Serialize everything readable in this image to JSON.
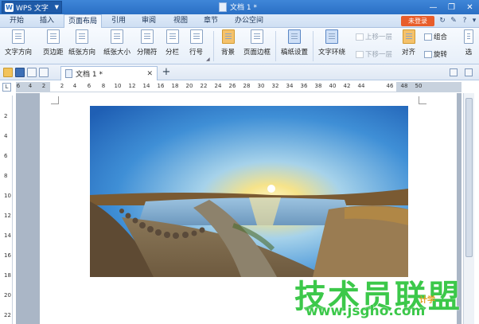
{
  "titlebar": {
    "app_name": "WPS 文字",
    "app_logo": "W",
    "doc_title": "文档 1 *",
    "controls": [
      "minimize-icon",
      "restore-icon",
      "close-icon"
    ]
  },
  "tabs": [
    {
      "label": "开始"
    },
    {
      "label": "插入"
    },
    {
      "label": "页面布局",
      "active": true
    },
    {
      "label": "引用"
    },
    {
      "label": "审阅"
    },
    {
      "label": "视图"
    },
    {
      "label": "章节"
    },
    {
      "label": "办公空间"
    }
  ],
  "login_label": "未登录",
  "help_label": "?",
  "ribbon": {
    "text_direction": "文字方向",
    "margins": "页边距",
    "orientation": "纸张方向",
    "size": "纸张大小",
    "breaks": "分隔符",
    "columns": "分栏",
    "line_numbers": "行号",
    "background": "背景",
    "page_border": "页面边框",
    "manuscript": "稿纸设置",
    "wrap_text": "文字环绕",
    "bring_forward": "上移一层",
    "send_backward": "下移一层",
    "align": "对齐",
    "group": "组合",
    "rotate": "旋转",
    "select": "选"
  },
  "doc_tab": {
    "label": "文档 1 *"
  },
  "ruler": {
    "corner": "L",
    "h_ticks": [
      "6",
      "4",
      "2",
      "2",
      "4",
      "6",
      "8",
      "10",
      "12",
      "14",
      "16",
      "18",
      "20",
      "22",
      "24",
      "26",
      "28",
      "30",
      "32",
      "34",
      "36",
      "38",
      "40",
      "42",
      "44",
      "46",
      "48",
      "50"
    ],
    "v_ticks": [
      "2",
      "4",
      "6",
      "8",
      "10",
      "12",
      "14",
      "16",
      "18",
      "20",
      "22"
    ]
  },
  "watermark": {
    "text": "技术员联盟",
    "url": "www.jsgho.com",
    "small": "计学"
  },
  "colors": {
    "title_blue": "#2a6fc4",
    "login_orange": "#e85d2a",
    "watermark_green": "#3cc84a"
  }
}
